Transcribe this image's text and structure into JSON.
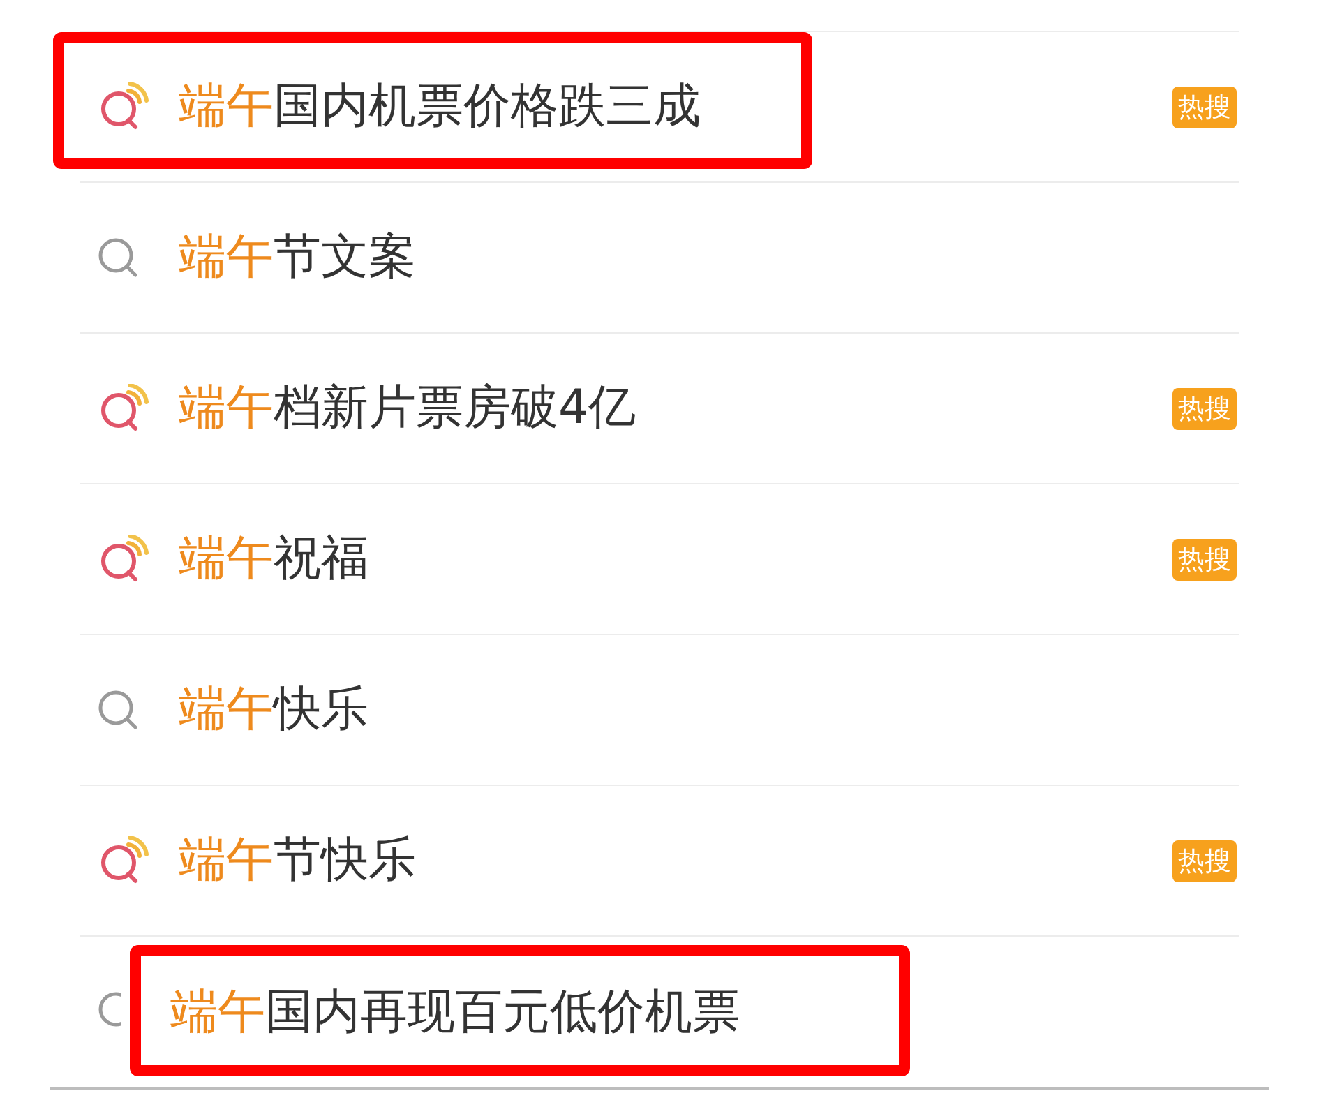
{
  "suggestions": [
    {
      "kind": "hot",
      "match": "端午",
      "rest": "国内机票价格跌三成",
      "badge": "热搜",
      "annotated": true
    },
    {
      "kind": "normal",
      "match": "端午",
      "rest": "节文案",
      "annotated": false
    },
    {
      "kind": "hot",
      "match": "端午",
      "rest": "档新片票房破4亿",
      "badge": "热搜",
      "annotated": false
    },
    {
      "kind": "hot",
      "match": "端午",
      "rest": "祝福",
      "badge": "热搜",
      "annotated": false
    },
    {
      "kind": "normal",
      "match": "端午",
      "rest": "快乐",
      "annotated": false
    },
    {
      "kind": "hot",
      "match": "端午",
      "rest": "节快乐",
      "badge": "热搜",
      "annotated": false
    },
    {
      "kind": "normal",
      "match": "端午",
      "rest": "国内再现百元低价机票",
      "annotated": true
    }
  ]
}
